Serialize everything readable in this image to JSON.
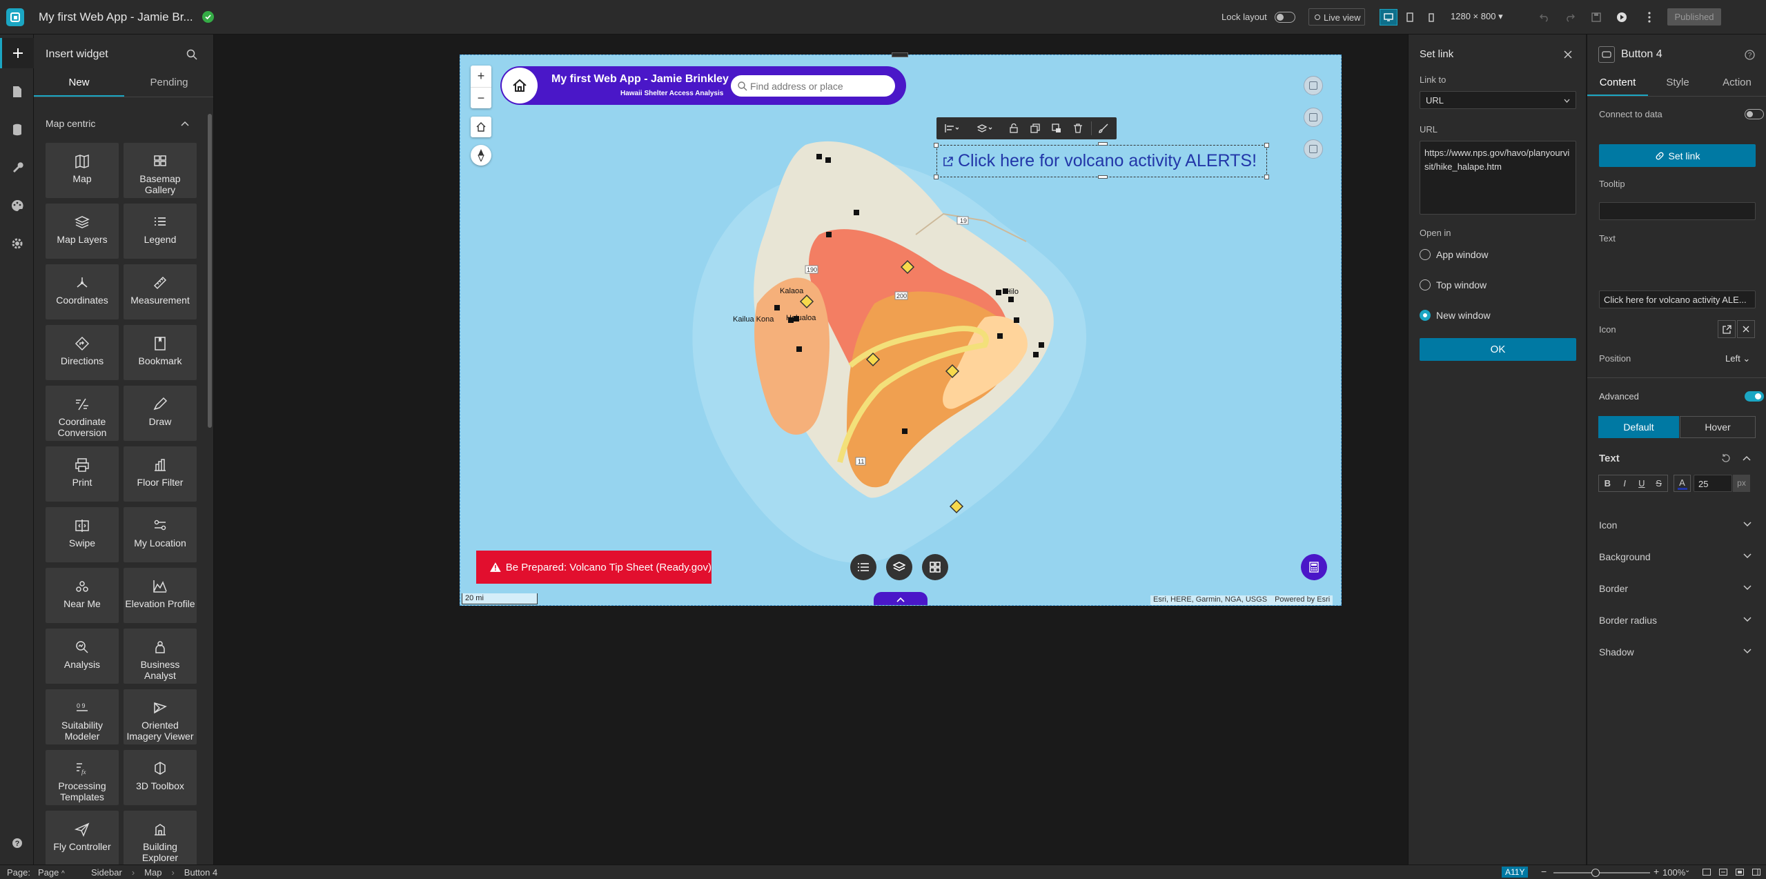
{
  "header": {
    "app_title": "My first Web App - Jamie Br...",
    "lock_layout_label": "Lock layout",
    "live_view_label": "Live view",
    "resolution": "1280 × 800",
    "published_label": "Published"
  },
  "widget_panel": {
    "title": "Insert widget",
    "tabs": [
      "New",
      "Pending"
    ],
    "section_title": "Map centric",
    "widgets": [
      {
        "label": "Map",
        "icon": "map-icon"
      },
      {
        "label": "Basemap Gallery",
        "icon": "basemap-gallery-icon"
      },
      {
        "label": "Map Layers",
        "icon": "layers-icon"
      },
      {
        "label": "Legend",
        "icon": "legend-icon"
      },
      {
        "label": "Coordinates",
        "icon": "coordinates-icon"
      },
      {
        "label": "Measurement",
        "icon": "ruler-icon"
      },
      {
        "label": "Directions",
        "icon": "directions-icon"
      },
      {
        "label": "Bookmark",
        "icon": "bookmark-icon"
      },
      {
        "label": "Coordinate Conversion",
        "icon": "coordinate-conversion-icon"
      },
      {
        "label": "Draw",
        "icon": "draw-icon"
      },
      {
        "label": "Print",
        "icon": "print-icon"
      },
      {
        "label": "Floor Filter",
        "icon": "floor-filter-icon"
      },
      {
        "label": "Swipe",
        "icon": "swipe-icon"
      },
      {
        "label": "My Location",
        "icon": "my-location-icon"
      },
      {
        "label": "Near Me",
        "icon": "near-me-icon"
      },
      {
        "label": "Elevation Profile",
        "icon": "elevation-profile-icon"
      },
      {
        "label": "Analysis",
        "icon": "analysis-icon"
      },
      {
        "label": "Business Analyst",
        "icon": "business-analyst-icon"
      },
      {
        "label": "Suitability Modeler",
        "icon": "suitability-modeler-icon"
      },
      {
        "label": "Oriented Imagery Viewer",
        "icon": "oriented-imagery-icon"
      },
      {
        "label": "Processing Templates",
        "icon": "processing-templates-icon"
      },
      {
        "label": "3D Toolbox",
        "icon": "3d-toolbox-icon"
      },
      {
        "label": "Fly Controller",
        "icon": "fly-controller-icon"
      },
      {
        "label": "Building Explorer",
        "icon": "building-explorer-icon"
      }
    ]
  },
  "map": {
    "app_header_title": "My first Web App - Jamie Brinkley",
    "app_header_subtitle": "Hawaii Shelter Access Analysis",
    "search_placeholder": "Find address or place",
    "alert_button_text": "Click here for volcano activity ALERTS!",
    "prepared_button_text": "Be Prepared: Volcano Tip Sheet (Ready.gov)",
    "scale_label": "20 mi",
    "attribution": "Esri, HERE, Garmin, NGA, USGS",
    "powered_by": "Powered by Esri",
    "place_labels": [
      "Hilo",
      "Kalaoa",
      "Kailua Kona",
      "Holualoa"
    ],
    "route_labels": [
      "19",
      "190",
      "200",
      "11",
      "11"
    ]
  },
  "link_panel": {
    "title": "Set link",
    "link_to_label": "Link to",
    "link_to_value": "URL",
    "url_label": "URL",
    "url_value": "https://www.nps.gov/havo/planyourvisit/hike_halape.htm",
    "open_in_label": "Open in",
    "options": [
      "App window",
      "Top window",
      "New window"
    ],
    "selected_option": "New window",
    "ok_label": "OK"
  },
  "settings": {
    "widget_name": "Button 4",
    "tabs": [
      "Content",
      "Style",
      "Action"
    ],
    "connect_label": "Connect to data",
    "set_link_label": "Set link",
    "tooltip_label": "Tooltip",
    "tooltip_value": "",
    "text_label": "Text",
    "text_value": "Click here for volcano activity ALE...",
    "icon_label": "Icon",
    "position_label": "Position",
    "position_value": "Left",
    "advanced_label": "Advanced",
    "state_tabs": [
      "Default",
      "Hover"
    ],
    "text_section": "Text",
    "font_size": "25",
    "font_unit": "px",
    "collapsed_sections": [
      "Icon",
      "Background",
      "Border",
      "Border radius",
      "Shadow"
    ]
  },
  "status": {
    "page_label": "Page:",
    "page_value": "Page",
    "breadcrumb": [
      "Sidebar",
      "Map",
      "Button 4"
    ],
    "a11y": "A11Y",
    "zoom": "100%"
  },
  "colors": {
    "accent": "#00a0b9",
    "brand_purple": "#4a17c8",
    "alert_red": "#e20f2e",
    "map_water": "#96d4ef",
    "button_blue": "#0079a3"
  }
}
